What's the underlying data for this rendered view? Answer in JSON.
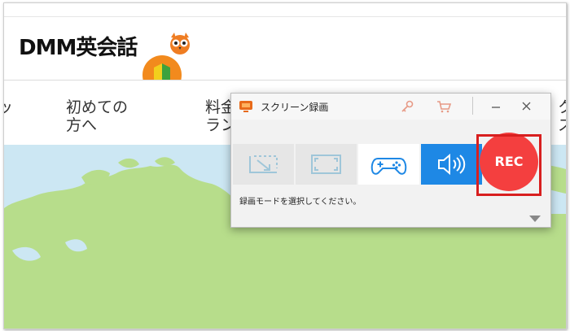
{
  "website": {
    "logo_text": "DMM英会話",
    "nav": [
      {
        "label_line1": "ッ",
        "label_line2": ""
      },
      {
        "label_line1": "初めての",
        "label_line2": "方へ"
      },
      {
        "label_line1": "料金",
        "label_line2": "ラン"
      },
      {
        "label_line1": "ク",
        "label_line2": "ス"
      }
    ]
  },
  "recorder": {
    "title": "スクリーン録画",
    "modes": [
      {
        "name": "region",
        "icon": "region-capture-icon"
      },
      {
        "name": "fullscreen",
        "icon": "fullscreen-capture-icon"
      },
      {
        "name": "game",
        "icon": "gamepad-icon",
        "selected": true
      },
      {
        "name": "audio",
        "icon": "speaker-icon",
        "active": true
      }
    ],
    "rec_label": "REC",
    "status_text": "録画モードを選択してください。",
    "colors": {
      "accent_blue": "#1e88e5",
      "rec_red": "#f43f3f",
      "highlight_red": "#d81f1f",
      "icon_muted": "#9fc6d9"
    }
  }
}
